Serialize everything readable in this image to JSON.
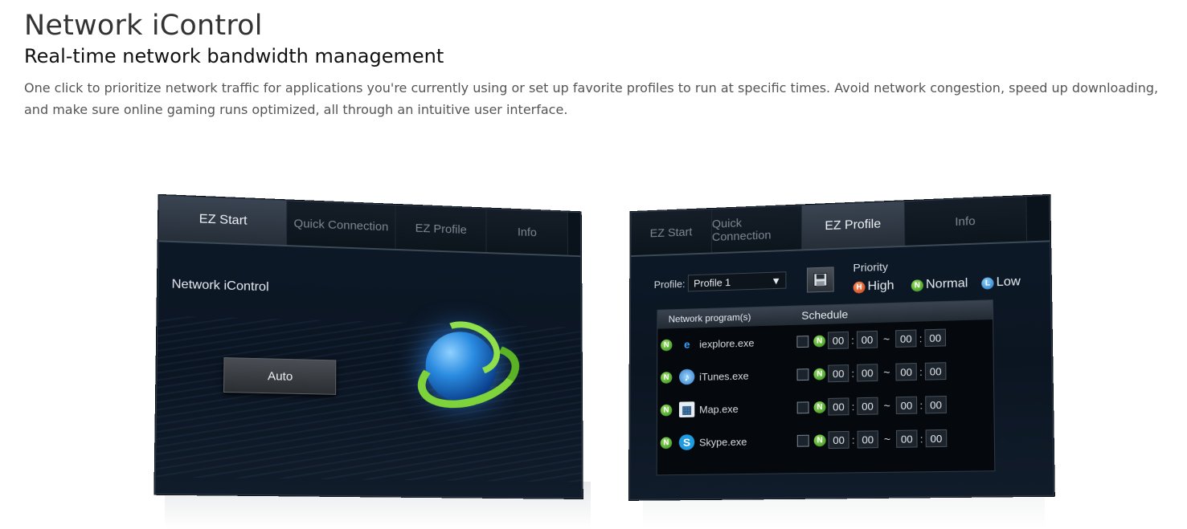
{
  "header": {
    "title": "Network iControl",
    "subtitle": "Real-time network bandwidth management",
    "description": "One click to prioritize network traffic for applications you're currently using or set up favorite profiles to run at specific times. Avoid network congestion, speed up downloading, and make sure online gaming runs optimized, all through an intuitive user interface."
  },
  "left_screen": {
    "tabs": [
      "EZ Start",
      "Quick Connection",
      "EZ Profile",
      "Info"
    ],
    "active_tab": "EZ Start",
    "title": "Network iControl",
    "auto_button": "Auto"
  },
  "right_screen": {
    "tabs": [
      "EZ Start",
      "Quick Connection",
      "EZ Profile",
      "Info"
    ],
    "active_tab": "EZ Profile",
    "profile_label": "Profile:",
    "profile_value": "Profile 1",
    "priority_label": "Priority",
    "priority_high": "High",
    "priority_normal": "Normal",
    "priority_low": "Low",
    "table_header_program": "Network program(s)",
    "table_header_schedule": "Schedule",
    "rows": [
      {
        "program": "iexplore.exe",
        "icon": "ie-icon",
        "start_h": "00",
        "start_m": "00",
        "end_h": "00",
        "end_m": "00"
      },
      {
        "program": "iTunes.exe",
        "icon": "itunes-icon",
        "start_h": "00",
        "start_m": "00",
        "end_h": "00",
        "end_m": "00"
      },
      {
        "program": "Map.exe",
        "icon": "map-icon",
        "start_h": "00",
        "start_m": "00",
        "end_h": "00",
        "end_m": "00"
      },
      {
        "program": "Skype.exe",
        "icon": "skype-icon",
        "start_h": "00",
        "start_m": "00",
        "end_h": "00",
        "end_m": "00"
      }
    ],
    "time_separator": ":",
    "range_separator": "~",
    "priority_badge_high": "H",
    "priority_badge_normal": "N",
    "priority_badge_low": "L"
  },
  "colors": {
    "screen_bg": "#0e1a28",
    "accent_green": "#7ed33a",
    "accent_blue": "#2a8be0"
  }
}
